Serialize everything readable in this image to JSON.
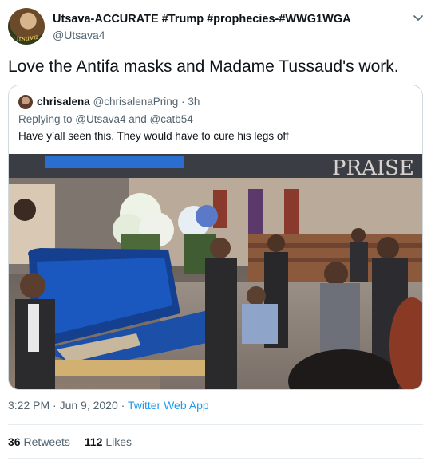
{
  "author": {
    "display_name": "Utsava-ACCURATE #Trump #prophecies-#WWG1WGA",
    "handle": "@Utsava4",
    "avatar_signature": "Utsava"
  },
  "tweet": {
    "text": "Love the Antifa masks and Madame Tussaud's work.",
    "time": "3:22 PM · Jun 9, 2020",
    "separator": " · ",
    "source": "Twitter Web App"
  },
  "quote": {
    "display_name": "chrisalena",
    "handle": "@chrisalenaPring",
    "age": "· 3h",
    "replying_to": "Replying to @Utsava4 and @catb54",
    "text": "Have y’all seen this. They would have to cure his legs off",
    "image_sign_text": "PRAISE"
  },
  "stats": {
    "retweets_count": "36",
    "retweets_label": "Retweets",
    "likes_count": "112",
    "likes_label": "Likes"
  },
  "colors": {
    "link": "#1d9bf0",
    "secondary_text": "#536471",
    "border": "#cfd9de"
  }
}
